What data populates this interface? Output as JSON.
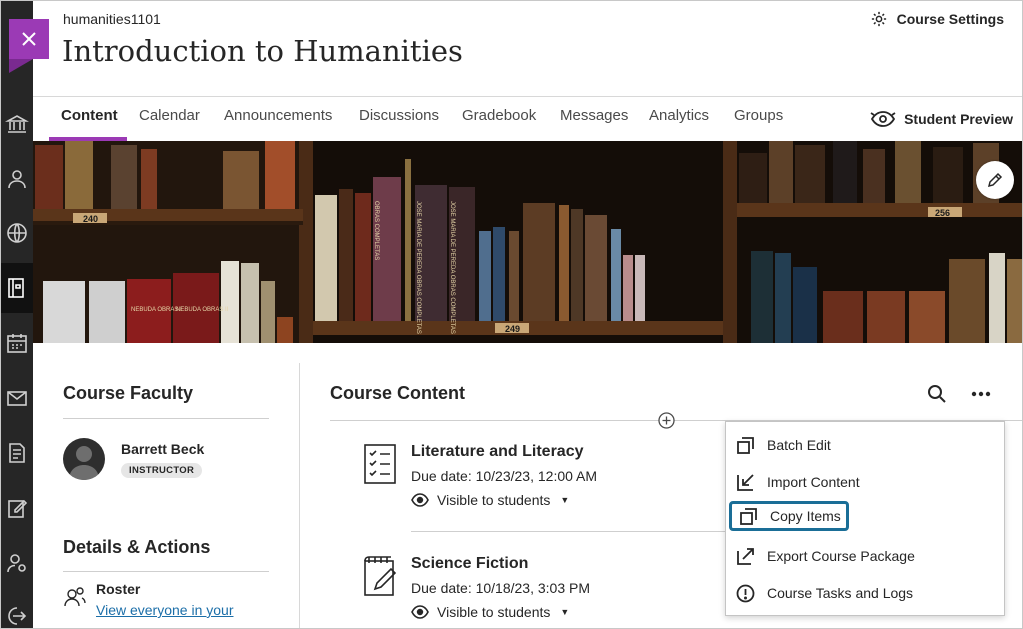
{
  "header": {
    "course_id": "humanities1101",
    "course_title": "Introduction to Humanities",
    "settings_label": "Course Settings"
  },
  "tabs": [
    {
      "label": "Content",
      "active": true
    },
    {
      "label": "Calendar"
    },
    {
      "label": "Announcements"
    },
    {
      "label": "Discussions"
    },
    {
      "label": "Gradebook"
    },
    {
      "label": "Messages"
    },
    {
      "label": "Analytics"
    },
    {
      "label": "Groups"
    }
  ],
  "student_preview_label": "Student Preview",
  "banner": {
    "shelf_labels": [
      "240",
      "249",
      "256"
    ],
    "book_spines": [
      "NEBUDA OBRAS I",
      "NEBUDA OBRAS II",
      "JOSE MARIA DE PEREDA OBRAS COMPLETAS",
      "JOSE MARIA DE PEREDA OBRAS COMPLETAS",
      "OBRAS COMPLETAS"
    ]
  },
  "sidebar": {
    "faculty_heading": "Course Faculty",
    "faculty": {
      "name": "Barrett Beck",
      "role": "INSTRUCTOR"
    },
    "details_heading": "Details & Actions",
    "roster_label": "Roster",
    "roster_link": "View everyone in your"
  },
  "course_content": {
    "heading": "Course Content",
    "items": [
      {
        "title": "Literature and Literacy",
        "due": "Due date: 10/23/23, 12:00 AM",
        "visibility": "Visible to students",
        "icon": "checklist-icon"
      },
      {
        "title": "Science Fiction",
        "due": "Due date: 10/18/23, 3:03 PM",
        "visibility": "Visible to students",
        "icon": "notebook-pencil-icon"
      }
    ]
  },
  "menu": {
    "items": [
      {
        "label": "Batch Edit",
        "icon": "batch-edit-icon"
      },
      {
        "label": "Import Content",
        "icon": "import-icon"
      },
      {
        "label": "Copy Items",
        "icon": "copy-icon",
        "focused": true
      },
      {
        "label": "Export Course Package",
        "icon": "export-icon"
      },
      {
        "label": "Course Tasks and Logs",
        "icon": "alert-circle-icon"
      }
    ]
  },
  "colors": {
    "accent": "#9b3ab5",
    "rail": "#262626",
    "focus_ring": "#1a6e97",
    "link": "#1b6ea8"
  }
}
